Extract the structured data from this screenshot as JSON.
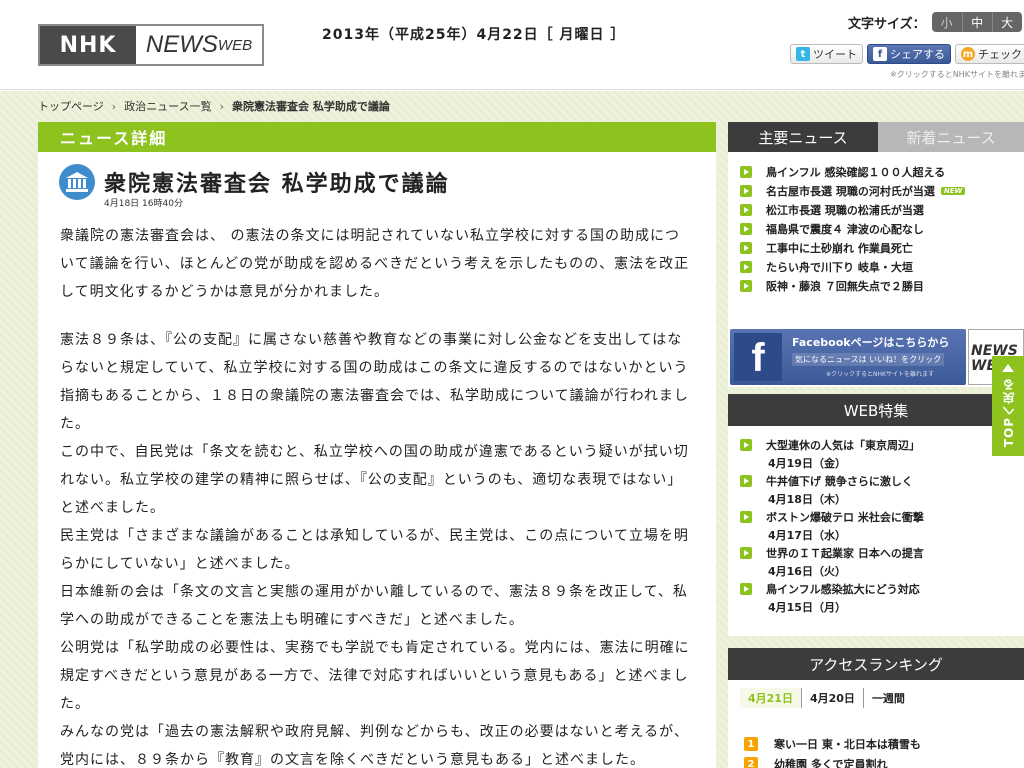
{
  "header": {
    "logo_nhk": "NHK",
    "logo_news": "NEWS",
    "logo_web": "WEB",
    "date": "2013年（平成25年）4月22日［ 月曜日 ］",
    "fontsize_label": "文字サイズ：",
    "fontsize_options": [
      "小",
      "中",
      "大"
    ],
    "share": {
      "tweet": "ツイート",
      "facebook": "シェアする",
      "mixi": "チェック",
      "note": "※クリックするとNHKサイトを離れます"
    }
  },
  "breadcrumb": [
    "トップページ",
    "政治ニュース一覧",
    "衆院憲法審査会 私学助成で議論"
  ],
  "main": {
    "section_title": "ニュース詳細",
    "article_title": "衆院憲法審査会 私学助成で議論",
    "article_time": "4月18日 16時40分",
    "paragraphs": [
      "衆議院の憲法審査会は、 の憲法の条文には明記されていない私立学校に対する国の助成について議論を行い、ほとんどの党が助成を認めるべきだという考えを示したものの、憲法を改正して明文化するかどうかは意見が分かれました。",
      "憲法８９条は、『公の支配』に属さない慈善や教育などの事業に対し公金などを支出してはならないと規定していて、私立学校に対する国の助成はこの条文に違反するのではないかという指摘もあることから、１８日の衆議院の憲法審査会では、私学助成について議論が行われました。",
      "この中で、自民党は「条文を読むと、私立学校への国の助成が違憲であるという疑いが拭い切れない。私立学校の建学の精神に照らせば、『公の支配』というのも、適切な表現ではない」と述べました。",
      "民主党は「さまざまな議論があることは承知しているが、民主党は、この点について立場を明らかにしていない」と述べました。",
      "日本維新の会は「条文の文言と実態の運用がかい離しているので、憲法８９条を改正して、私学への助成ができることを憲法上も明確にすべきだ」と述べました。",
      "公明党は「私学助成の必要性は、実務でも学説でも肯定されている。党内には、憲法に明確に規定すべきだという意見がある一方で、法律で対応すればいいという意見もある」と述べました。",
      "みんなの党は「過去の憲法解釈や政府見解、判例などからも、改正の必要はないと考えるが、党内には、８９条から『教育』の文言を除くべきだという意見もある」と述べました。"
    ]
  },
  "right": {
    "tabs": [
      "主要ニュース",
      "新着ニュース"
    ],
    "top_news": [
      "鳥インフル 感染確認１００人超える",
      "名古屋市長選 現職の河村氏が当選",
      "松江市長選 現職の松浦氏が当選",
      "福島県で震度４ 津波の心配なし",
      "工事中に土砂崩れ 作業員死亡",
      "たらい舟で川下り 岐阜・大垣",
      "阪神・藤浪 ７回無失点で２勝目"
    ],
    "new_badge": "NEW",
    "facebook_banner": {
      "title": "Facebookページはこちらから",
      "sub": "気になるニュースは いいね！をクリック",
      "note": "※クリックするとNHKサイトを離れます",
      "nhk_news": "NEWS WEB"
    },
    "web_title": "WEB特集",
    "web_items": [
      {
        "title": "大型連休の人気は「東京周辺」",
        "date": "4月19日（金）"
      },
      {
        "title": "牛丼値下げ 競争さらに激しく",
        "date": "4月18日（木）"
      },
      {
        "title": "ボストン爆破テロ 米社会に衝撃",
        "date": "4月17日（水）"
      },
      {
        "title": "世界のＩＴ起業家 日本への提言",
        "date": "4月16日（火）"
      },
      {
        "title": "鳥インフル感染拡大にどう対応",
        "date": "4月15日（月）"
      }
    ],
    "ranking_title": "アクセスランキング",
    "ranking_tabs": [
      "4月21日",
      "4月20日",
      "一週間"
    ],
    "ranking_items": [
      {
        "rank": "1",
        "title": "寒い一日 東・北日本は積雪も"
      },
      {
        "rank": "2",
        "title": "幼稚園 多くで定員割れ"
      }
    ]
  },
  "top_button": "TOPへ戻る"
}
